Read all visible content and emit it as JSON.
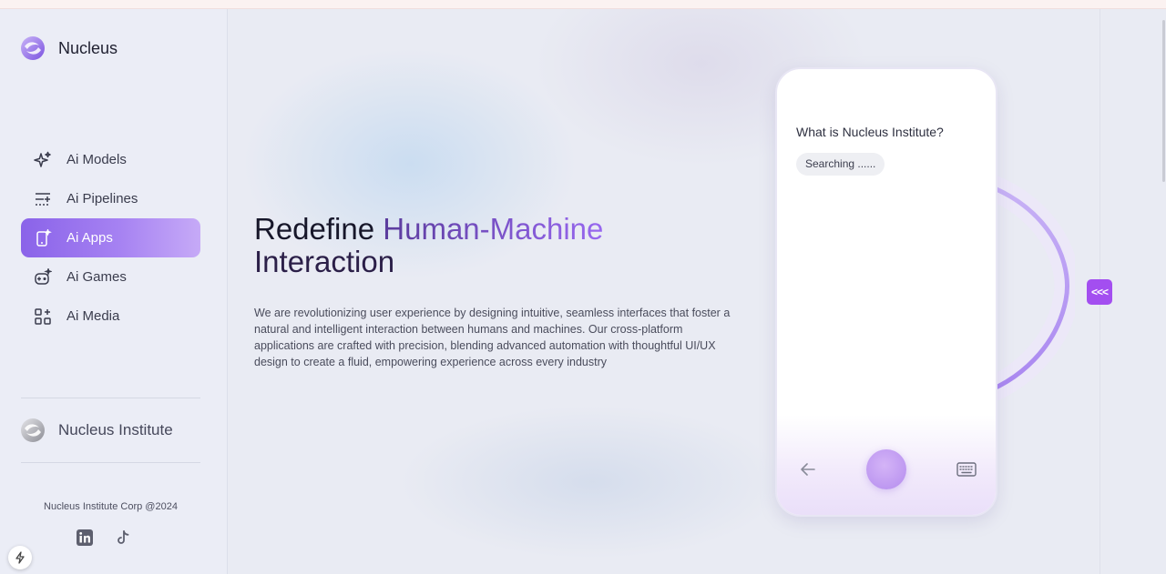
{
  "brand": {
    "name": "Nucleus"
  },
  "nav": {
    "items": [
      {
        "label": "Ai Models",
        "icon": "sparkle-icon",
        "active": false
      },
      {
        "label": "Ai Pipelines",
        "icon": "pipeline-icon",
        "active": false
      },
      {
        "label": "Ai Apps",
        "icon": "phone-sparkle-icon",
        "active": true
      },
      {
        "label": "Ai Games",
        "icon": "gamepad-icon",
        "active": false
      },
      {
        "label": "Ai Media",
        "icon": "grid-plus-icon",
        "active": false
      }
    ]
  },
  "institute": {
    "name": "Nucleus Institute"
  },
  "footer": {
    "copyright": "Nucleus Institute Corp @2024",
    "socials": [
      "linkedin-icon",
      "tiktok-icon"
    ]
  },
  "hero": {
    "title_plain": "Redefine ",
    "title_highlight": "Human-Machine",
    "title_tail": "Interaction",
    "description": "We are revolutionizing user experience by designing intuitive, seamless interfaces that foster a natural and intelligent interaction between humans and machines. Our cross-platform applications are crafted with precision, blending advanced automation with thoughtful UI/UX design to create a fluid, empowering experience across every industry"
  },
  "phone": {
    "question": "What is Nucleus Institute?",
    "status": "Searching ......"
  },
  "collapse_button": {
    "label": "<<<"
  },
  "colors": {
    "accent": "#a34ef0",
    "active_nav_start": "#8a63e9",
    "active_nav_end": "#c6aaf7"
  }
}
